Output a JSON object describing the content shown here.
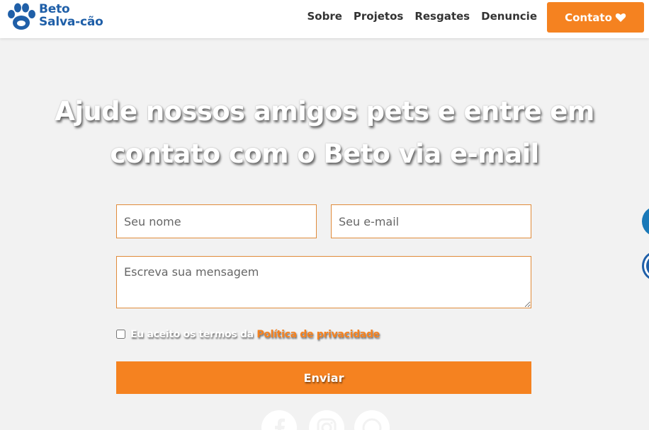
{
  "brand": {
    "line1": "Beto",
    "line2": "Salva-cão"
  },
  "nav": {
    "items": [
      "Sobre",
      "Projetos",
      "Resgates",
      "Denuncie"
    ],
    "contact_label": "Contato"
  },
  "hero": {
    "title_line1": "Ajude nossos amigos pets e entre em",
    "title_line2": "contato com o Beto via e-mail"
  },
  "form": {
    "name_placeholder": "Seu nome",
    "email_placeholder": "Seu e-mail",
    "message_placeholder": "Escreva sua mensagem",
    "terms_text": "Eu aceito os termos da ",
    "terms_link": "Política de privacidade",
    "submit_label": "Enviar"
  },
  "colors": {
    "accent": "#f58220",
    "brand": "#1f5fa8",
    "background": "#f2f2f2"
  },
  "icons": {
    "logo": "paw-icon",
    "contact": "heart-icon",
    "social": [
      "facebook-icon",
      "instagram-icon",
      "whatsapp-icon"
    ]
  }
}
